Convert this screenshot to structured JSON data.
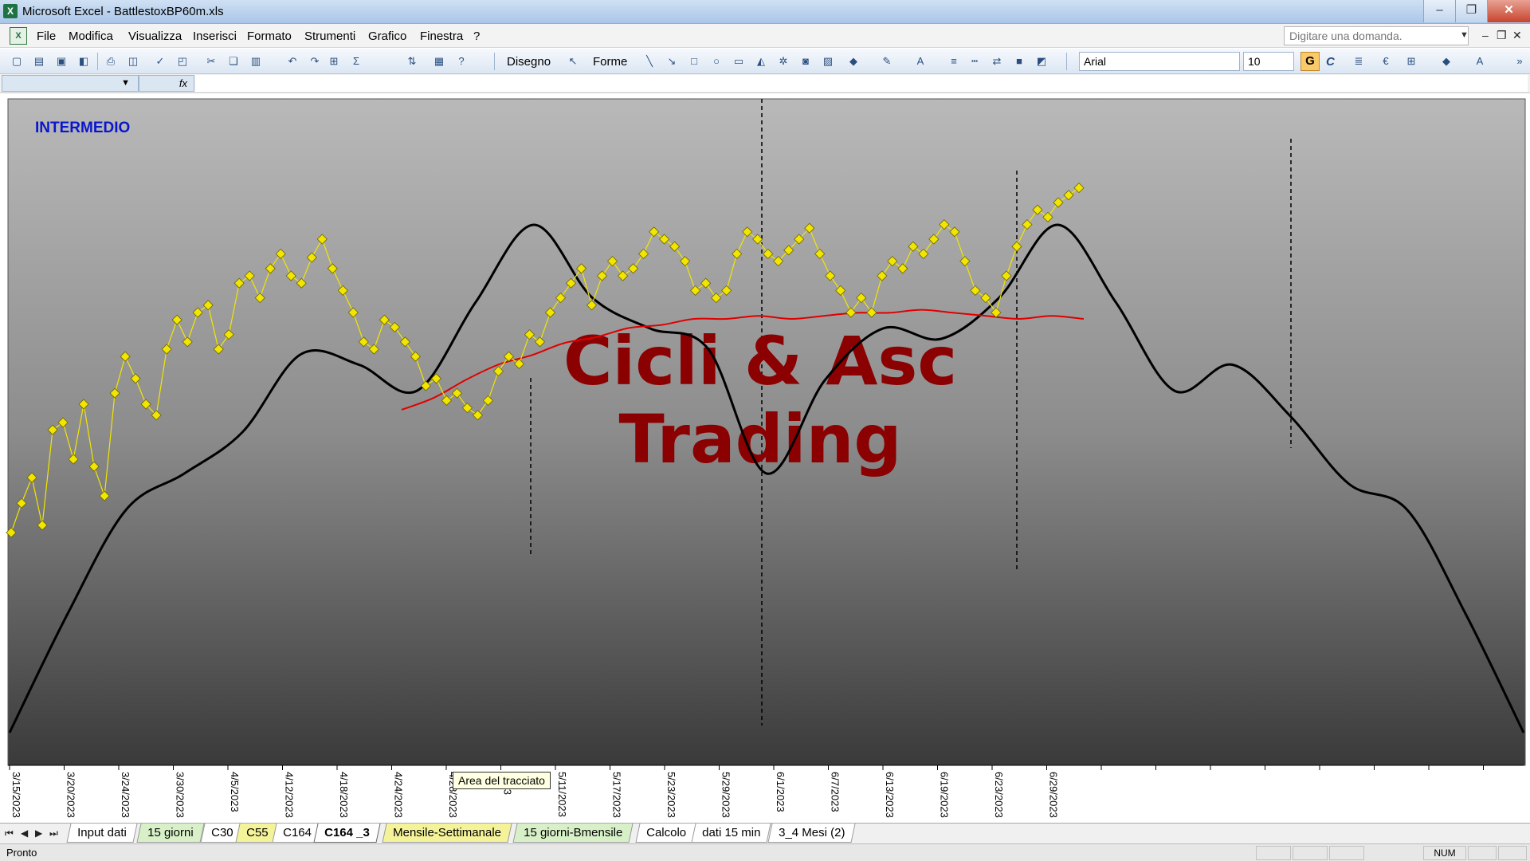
{
  "window": {
    "app_title": "Microsoft Excel - BattlestoxBP60m.xls",
    "buttons": [
      "–",
      "❐",
      "✕"
    ]
  },
  "menu": {
    "items": [
      "File",
      "Modifica",
      "Visualizza",
      "Inserisci",
      "Formato",
      "Strumenti",
      "Grafico",
      "Finestra",
      "?"
    ],
    "ask_placeholder": "Digitare una domanda."
  },
  "toolbar": {
    "draw_label": "Disegno",
    "shapes_label": "Forme",
    "font_name": "Arial",
    "font_size": "10",
    "bold_label": "G",
    "italic_label": "C"
  },
  "formula": {
    "fx_label": "fx"
  },
  "chart": {
    "label": "INTERMEDIO",
    "watermark_line1": "Cicli & Asc",
    "watermark_line2": "Trading",
    "tooltip": "Area del tracciato"
  },
  "chart_data": {
    "type": "line",
    "x_tick_labels": [
      "3/15/2023",
      "3/20/2023",
      "3/24/2023",
      "3/30/2023",
      "4/5/2023",
      "4/12/2023",
      "4/18/2023",
      "4/24/2023",
      "4/28/2023",
      "2023",
      "5/11/2023",
      "5/17/2023",
      "5/23/2023",
      "5/29/2023",
      "6/1/2023",
      "6/7/2023",
      "6/13/2023",
      "6/19/2023",
      "6/23/2023",
      "6/29/2023"
    ],
    "ylim": [
      0,
      100
    ],
    "grid": false,
    "legend": "none",
    "colors": {
      "price": "#f2e600",
      "average": "#e00000",
      "cycle": "#000000"
    },
    "series": [
      {
        "values": [
          20,
          28,
          35,
          22,
          48,
          50,
          40,
          55,
          38,
          30,
          58,
          68,
          62,
          55,
          52,
          70,
          78,
          72,
          80,
          82,
          70,
          74,
          88,
          90,
          84,
          92,
          96,
          90,
          88,
          95,
          100,
          92,
          86,
          80,
          72,
          70,
          78,
          76,
          72,
          68,
          60,
          62,
          56,
          58,
          54,
          52,
          56,
          64,
          68,
          66,
          74,
          72,
          80,
          84,
          88,
          92,
          82,
          90,
          94,
          90,
          92,
          96,
          102,
          100,
          98,
          94,
          86,
          88,
          84,
          86,
          96,
          102,
          100,
          96,
          94,
          97,
          100,
          103,
          96,
          90,
          86,
          80,
          84,
          80,
          90,
          94,
          92,
          98,
          96,
          100,
          104,
          102,
          94,
          86,
          84,
          80,
          90,
          98,
          104,
          108,
          106,
          110,
          112,
          114
        ]
      },
      {
        "values": [
          48,
          52,
          58,
          63,
          66,
          70,
          72,
          75,
          76,
          78,
          78,
          79,
          78,
          79,
          80,
          80,
          81,
          80,
          79,
          78,
          79,
          78
        ]
      },
      {
        "values": [
          2,
          25,
          45,
          52,
          60,
          75,
          73,
          68,
          85,
          100,
          86,
          80,
          76,
          52,
          70,
          80,
          78,
          86,
          100,
          85,
          68,
          73,
          63,
          50,
          45,
          25,
          2
        ]
      }
    ]
  },
  "sheets": {
    "tabs": [
      "Input dati",
      "15 giorni",
      "C30",
      "C55",
      "C164",
      "C164 _3",
      "Mensile-Settimanale",
      "15 giorni-Bmensile",
      "Calcolo",
      "dati 15 min",
      "3_4 Mesi (2)"
    ],
    "active": "C164 _3"
  },
  "status": {
    "ready": "Pronto",
    "num": "NUM"
  }
}
